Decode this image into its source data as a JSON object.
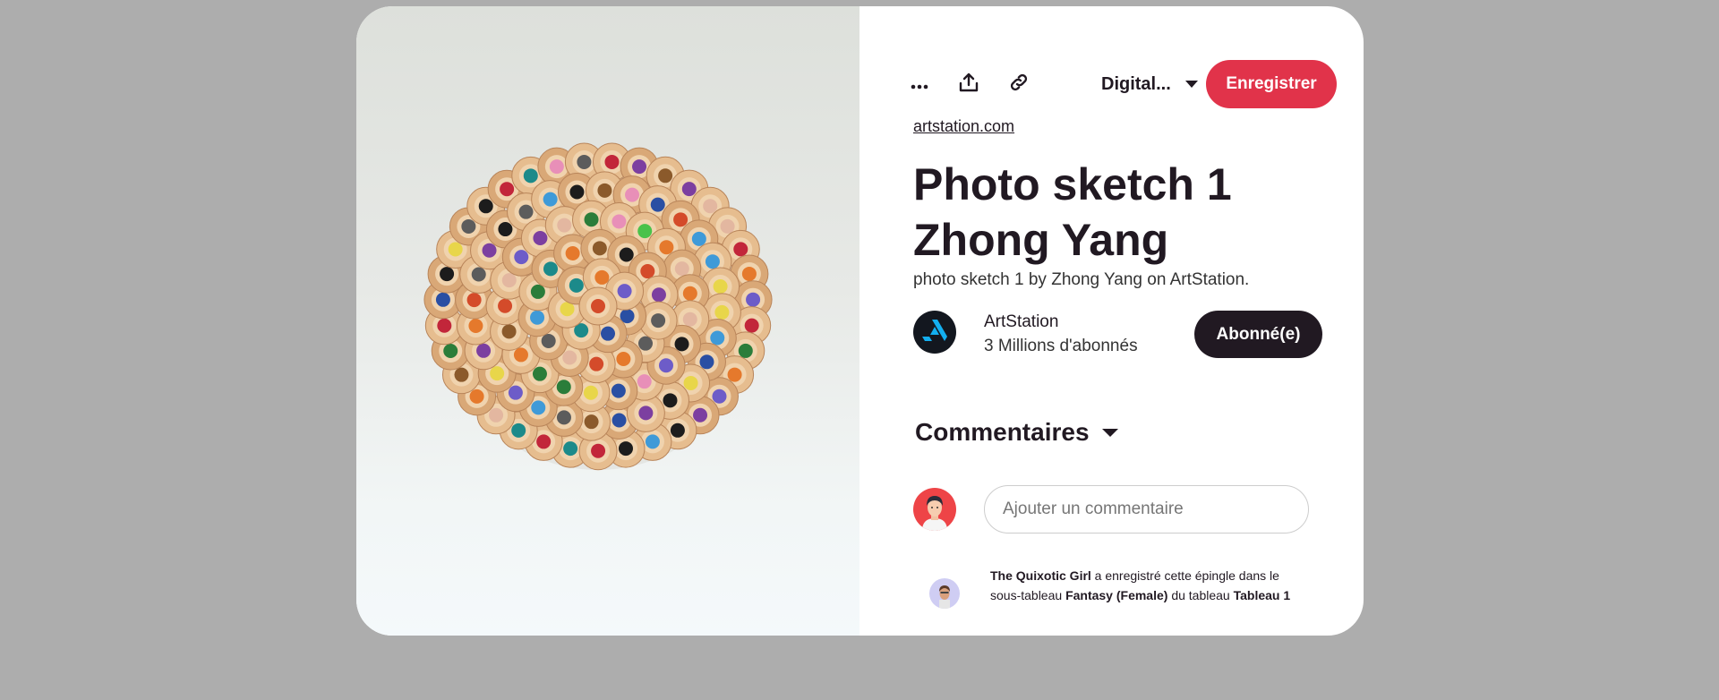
{
  "pin": {
    "image_alt": "Colored pencils viewed from above",
    "source_link": "artstation.com",
    "title": "Photo sketch 1 Zhong Yang",
    "description": "photo sketch 1 by Zhong Yang on ArtStation."
  },
  "toolbar": {
    "more_icon": "more-icon",
    "share_icon": "share-upload-icon",
    "link_icon": "link-icon",
    "board_select_label": "Digital...",
    "save_label": "Enregistrer"
  },
  "creator": {
    "name": "ArtStation",
    "followers": "3 Millions d'abonnés",
    "follow_label": "Abonné(e)"
  },
  "comments": {
    "title": "Commentaires",
    "input_placeholder": "Ajouter un commentaire"
  },
  "activity": {
    "user": "The Quixotic Girl",
    "text_1": " a enregistré cette épingle dans le sous-tableau ",
    "subboard": "Fantasy (Female)",
    "text_2": " du tableau ",
    "board": "Tableau 1"
  },
  "colors": {
    "save_button": "#e1334a",
    "follow_button": "#211922",
    "background": "#adadad"
  }
}
